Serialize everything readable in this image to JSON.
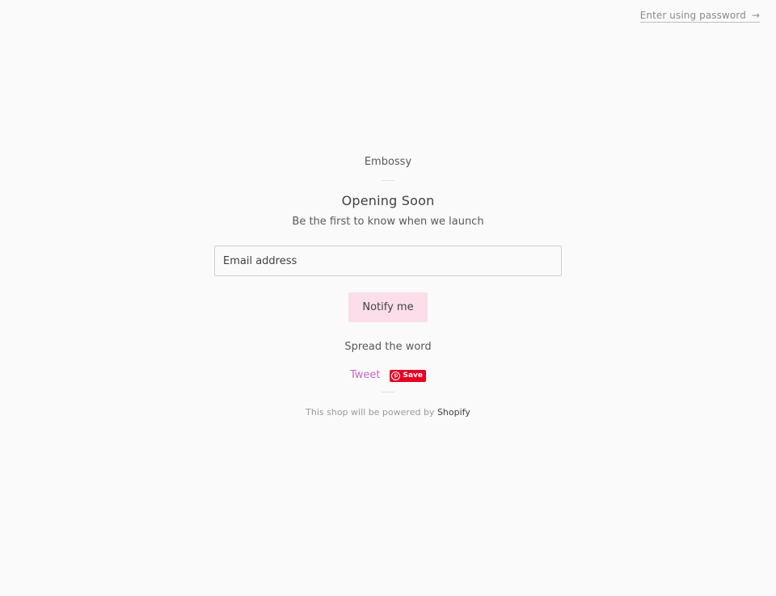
{
  "header": {
    "password_link_label": "Enter using password",
    "password_link_arrow": "→"
  },
  "main": {
    "shop_name": "Embossy",
    "headline": "Opening Soon",
    "subline": "Be the first to know when we launch",
    "email_placeholder": "Email address",
    "notify_label": "Notify me",
    "spread_label": "Spread the word",
    "tweet_label": "Tweet",
    "save_label": "Save"
  },
  "footer": {
    "powered_prefix": "This shop will be powered by",
    "powered_brand": "Shopify"
  },
  "colors": {
    "background": "#fafafa",
    "button_bg": "#fbdeea",
    "tweet_link": "#c06ac6",
    "pinterest_red": "#e60023"
  },
  "icons": {
    "pinterest": "pinterest-icon"
  }
}
